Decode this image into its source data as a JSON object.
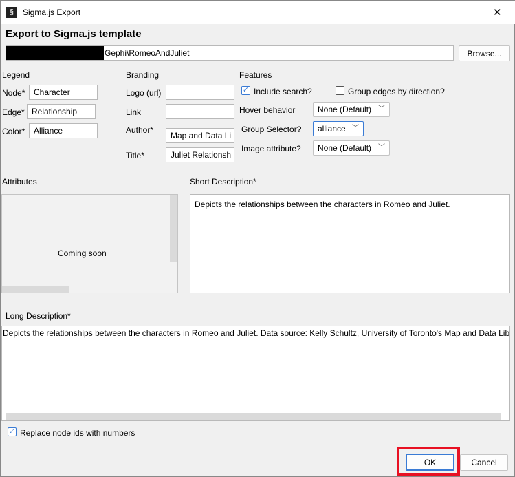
{
  "window": {
    "title": "Sigma.js Export",
    "close": "✕"
  },
  "header": "Export to Sigma.js template",
  "path": {
    "value": "Gephi\\RomeoAndJuliet",
    "browse": "Browse..."
  },
  "legend": {
    "title": "Legend",
    "node_label": "Node*",
    "node": "Character",
    "edge_label": "Edge*",
    "edge": "Relationship",
    "color_label": "Color*",
    "color": "Alliance"
  },
  "branding": {
    "title": "Branding",
    "logo_label": "Logo (url)",
    "logo": "",
    "link_label": "Link",
    "link": "",
    "author_label": "Author*",
    "author": "Map and Data Li",
    "title_label": "Title*",
    "title_value": "Juliet Relationsh"
  },
  "features": {
    "title": "Features",
    "include_search": "Include search?",
    "group_edges": "Group edges by direction?",
    "hover_label": "Hover behavior",
    "hover": "None (Default)",
    "group_label": "Group Selector?",
    "group": "alliance",
    "image_label": "Image attribute?",
    "image": "None (Default)"
  },
  "attributes": {
    "title": "Attributes",
    "placeholder": "Coming soon"
  },
  "short_desc": {
    "label": "Short Description*",
    "value": "Depicts the relationships between the characters in Romeo and Juliet."
  },
  "long_desc": {
    "label": "Long Description*",
    "value": "Depicts the relationships between the characters in Romeo and Juliet. Data source: Kelly Schultz, University of Toronto's Map and Data Library"
  },
  "replace_ids": "Replace node ids with numbers",
  "buttons": {
    "ok": "OK",
    "cancel": "Cancel"
  },
  "colors": {
    "accent": "#3a7bd5",
    "highlight": "#e81123"
  }
}
